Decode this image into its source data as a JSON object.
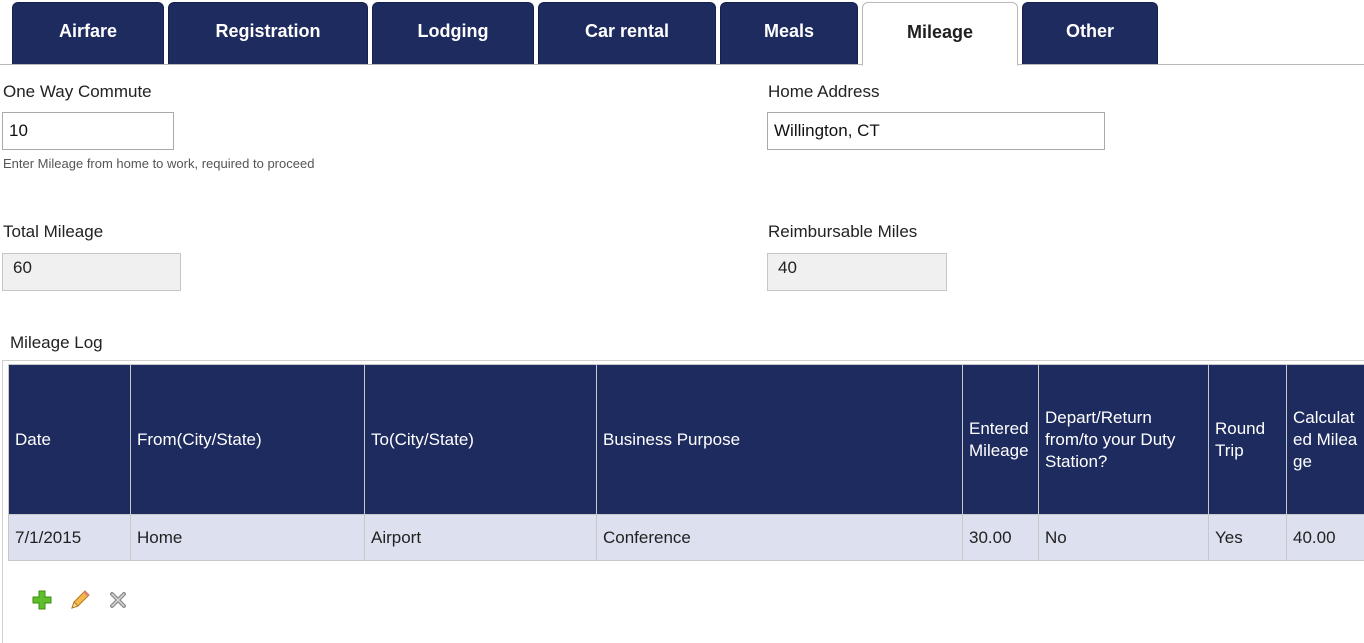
{
  "tabs": [
    {
      "label": "Airfare",
      "active": false
    },
    {
      "label": "Registration",
      "active": false
    },
    {
      "label": "Lodging",
      "active": false
    },
    {
      "label": "Car rental",
      "active": false
    },
    {
      "label": "Meals",
      "active": false
    },
    {
      "label": "Mileage",
      "active": true
    },
    {
      "label": "Other",
      "active": false
    }
  ],
  "form": {
    "commute_label": "One Way Commute",
    "commute_value": "10",
    "commute_hint": "Enter Mileage from home to work, required to proceed",
    "home_label": "Home Address",
    "home_value": "Willington, CT",
    "total_label": "Total Mileage",
    "total_value": "60",
    "reimb_label": "Reimbursable Miles",
    "reimb_value": "40"
  },
  "log": {
    "title": "Mileage Log",
    "headers": [
      "Date",
      "From(City/State)",
      "To(City/State)",
      "Business Purpose",
      "Entered Mileage",
      "Depart/Return from/to your Duty Station?",
      "Round Trip",
      "Calculated Mileage"
    ],
    "rows": [
      [
        "7/1/2015",
        "Home",
        "Airport",
        "Conference",
        "30.00",
        "No",
        "Yes",
        "40.00"
      ]
    ]
  },
  "actions": {
    "add_icon": "plus-icon",
    "edit_icon": "pencil-icon",
    "delete_icon": "x-icon",
    "add_color": "#5fbf2a",
    "edit_color": "#e8a030"
  }
}
